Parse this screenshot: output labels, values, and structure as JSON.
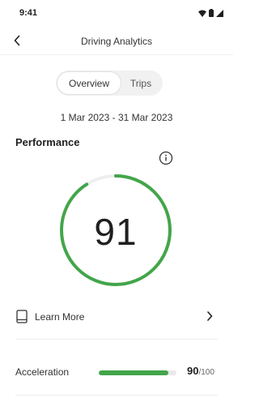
{
  "status_bar": {
    "time": "9:41",
    "icons": [
      "wifi-icon",
      "battery-icon",
      "signal-icon"
    ]
  },
  "app_bar": {
    "title": "Driving Analytics",
    "back_icon": "chevron-left-icon"
  },
  "tabs": [
    {
      "label": "Overview",
      "active": true
    },
    {
      "label": "Trips",
      "active": false
    }
  ],
  "date_range": "1 Mar 2023 - 31 Mar 2023",
  "performance": {
    "title": "Performance",
    "info_icon": "info-icon",
    "score": "91",
    "score_fraction": 0.91
  },
  "learn_more": {
    "label": "Learn More",
    "icon": "book-icon",
    "chevron": "chevron-right-icon"
  },
  "metrics": [
    {
      "label": "Acceleration",
      "value": "90",
      "max": "/100",
      "fraction": 0.9
    }
  ],
  "colors": {
    "accent_green": "#43a54a",
    "track_gray": "#efefef"
  }
}
